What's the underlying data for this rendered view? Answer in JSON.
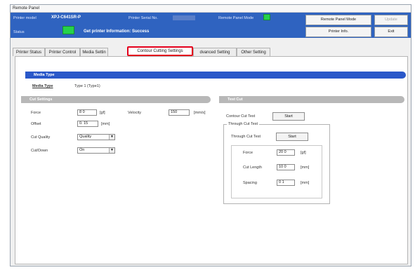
{
  "window": {
    "title": "Remote Panel"
  },
  "info": {
    "printer_model_label": "Printer model",
    "printer_model_value": "XPJ-C641SR-P",
    "serial_label": "Printer Serial No.",
    "panel_mode_label": "Remote Panel Mode",
    "status_label": "Status",
    "status_message": "Get printer Information: Success"
  },
  "buttons": {
    "remote_panel_mode": "Remote Panel Mode",
    "disabled_top": "Update",
    "printer_info": "Printer Info.",
    "exit": "Exit"
  },
  "tabs": [
    {
      "label": "Printer Status"
    },
    {
      "label": "Printer Control"
    },
    {
      "label": "Media Settin"
    },
    {
      "label": "Contour Cutting Settings"
    },
    {
      "label": "dvanced Setting"
    },
    {
      "label": "Other Setting"
    }
  ],
  "media": {
    "section_title": "Media Type",
    "label": "Media Type",
    "value": "Type 1 (Type1)"
  },
  "cut_settings": {
    "title": "Cut Settings",
    "force_label": "Force",
    "force_value": "8  0",
    "force_unit": "[gf]",
    "velocity_label": "Velocity",
    "velocity_value": "150",
    "velocity_unit": "[mm/s]",
    "offset_label": "Offset",
    "offset_value": "0. 15",
    "offset_unit": "[mm]",
    "cut_quality_label": "Cut Quality",
    "cut_quality_value": "Quality",
    "cut_down_label": "Cut/Down",
    "cut_down_value": "On"
  },
  "test_cut": {
    "title": "Test Cut",
    "contour_label": "Contour Cut Test",
    "contour_button": "Start",
    "through_group": "Through Cut Test",
    "through_label": "Through Cut Test",
    "through_button": "Start",
    "force_label": "Force",
    "force_value": "20  0",
    "force_unit": "[gf]",
    "length_label": "Cut Length",
    "length_value": "10   0",
    "length_unit": "[mm]",
    "spacing_label": "Spacing",
    "spacing_value": "0   1",
    "spacing_unit": "[mm]"
  },
  "colors": {
    "header_blue": "#2f63c0",
    "status_green": "#26d24a",
    "section_blue": "#2a58c9",
    "highlight_red": "#e4001c"
  }
}
